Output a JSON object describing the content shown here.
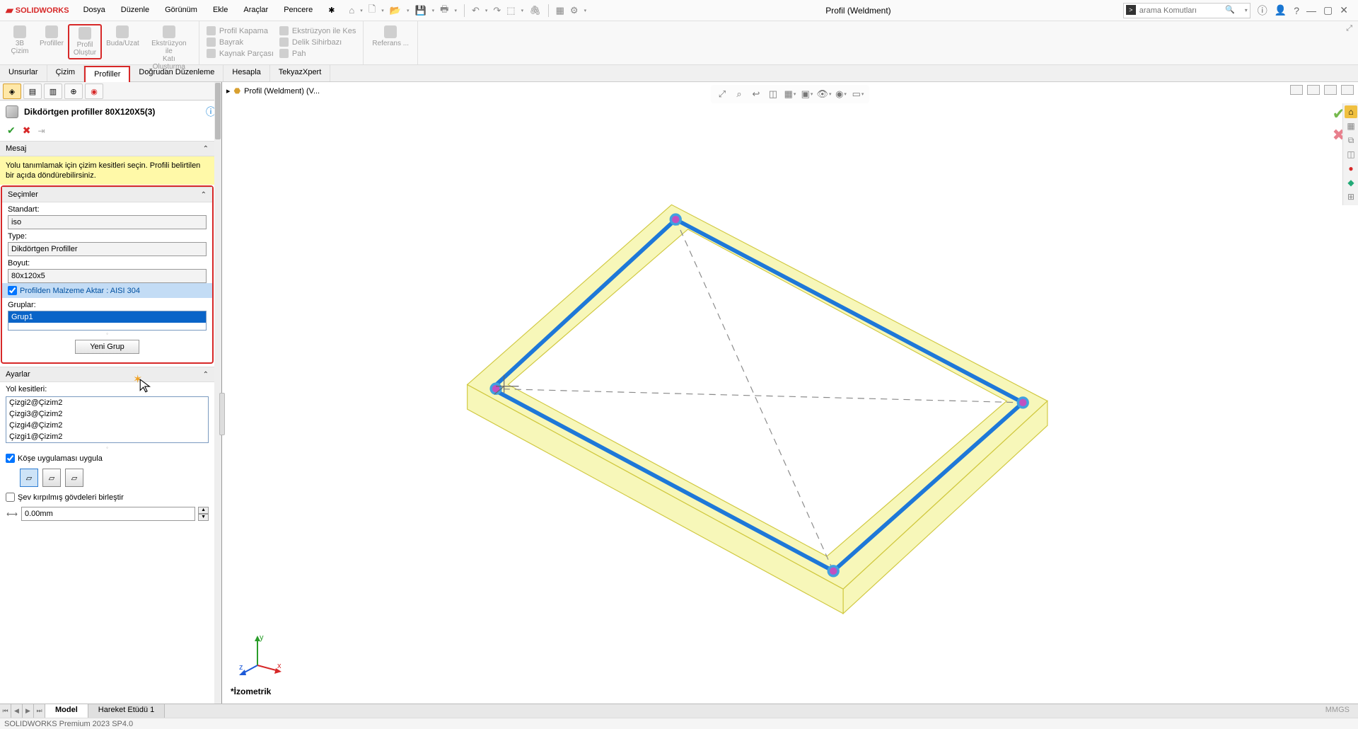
{
  "app": {
    "name": "SOLIDWORKS",
    "doc_title": "Profil (Weldment)"
  },
  "menu": [
    "Dosya",
    "Düzenle",
    "Görünüm",
    "Ekle",
    "Araçlar",
    "Pencere"
  ],
  "search": {
    "placeholder": "arama Komutları"
  },
  "ribbon": {
    "big": [
      {
        "label": "3B\nÇizim"
      },
      {
        "label": "Profiller"
      },
      {
        "label": "Profil\nOluştur"
      },
      {
        "label": "Buda/Uzat"
      },
      {
        "label": "Ekstrüzyon ile\nKatı Oluşturma"
      }
    ],
    "col1": [
      "Profil Kapama",
      "Bayrak",
      "Kaynak Parçası"
    ],
    "col2": [
      "Ekstrüzyon ile Kes",
      "Delik Sihirbazı",
      "Pah"
    ],
    "ref": "Referans ..."
  },
  "tabs": [
    "Unsurlar",
    "Çizim",
    "Profiller",
    "Doğrudan Düzenleme",
    "Hesapla",
    "TekyazXpert"
  ],
  "active_tab": "Profiller",
  "feature": {
    "title": "Dikdörtgen profiller 80X120X5(3)",
    "msg_head": "Mesaj",
    "msg_body": "Yolu tanımlamak için çizim kesitleri seçin. Profili belirtilen bir açıda döndürebilirsiniz.",
    "secimler": "Seçimler",
    "standart_l": "Standart:",
    "standart_v": "iso",
    "type_l": "Type:",
    "type_v": "Dikdörtgen Profiller",
    "boyut_l": "Boyut:",
    "boyut_v": "80x120x5",
    "mat_chk": "Profilden Malzeme Aktar : AISI 304",
    "gruplar_l": "Gruplar:",
    "grup1": "Grup1",
    "yeni_grup": "Yeni Grup",
    "ayarlar": "Ayarlar",
    "yol_l": "Yol kesitleri:",
    "yollar": [
      "Çizgi2@Çizim2",
      "Çizgi3@Çizim2",
      "Çizgi4@Çizim2",
      "Çizgi1@Çizim2"
    ],
    "kose_chk": "Köşe uygulaması uygula",
    "sev_chk": "Şev kırpılmış gövdeleri birleştir",
    "spin_v": "0.00mm"
  },
  "breadcrumb": "Profil (Weldment) (V...",
  "iso": "*İzometrik",
  "bottom": {
    "tabs": [
      "Model",
      "Hareket Etüdü 1"
    ],
    "active": "Model",
    "units": "MMGS"
  },
  "status": "SOLIDWORKS Premium 2023 SP4.0"
}
